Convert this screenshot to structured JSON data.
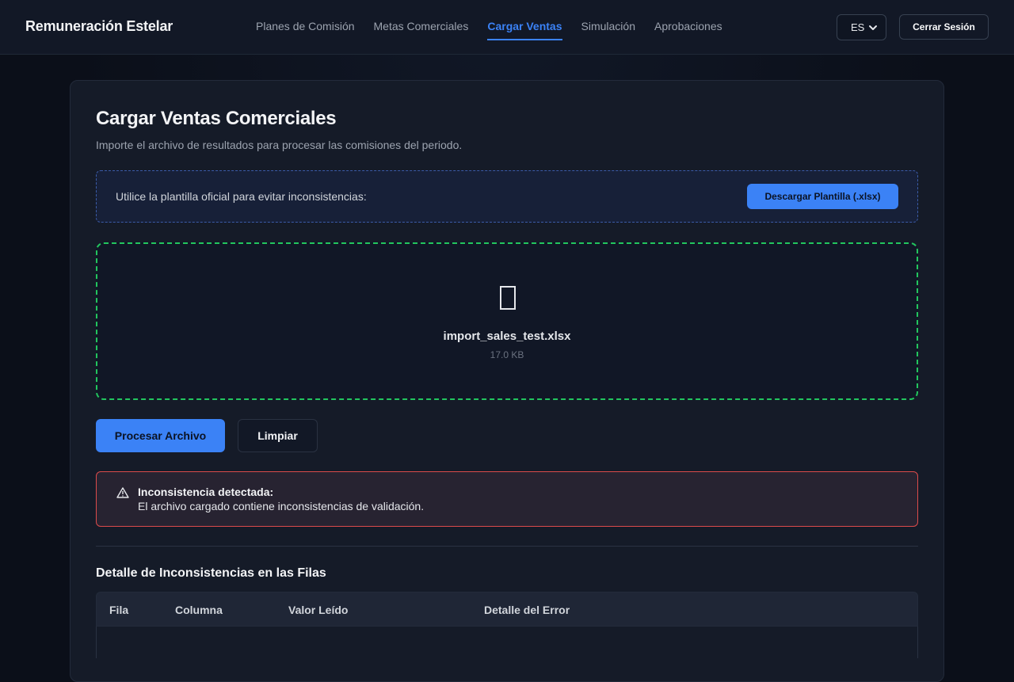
{
  "app": {
    "title": "Remuneración Estelar"
  },
  "nav": {
    "items": [
      {
        "label": "Planes de Comisión"
      },
      {
        "label": "Metas Comerciales"
      },
      {
        "label": "Cargar Ventas",
        "active": true
      },
      {
        "label": "Simulación"
      },
      {
        "label": "Aprobaciones"
      }
    ]
  },
  "header": {
    "language": "ES",
    "logout_label": "Cerrar Sesión"
  },
  "upload": {
    "title": "Cargar Ventas Comerciales",
    "subtitle": "Importe el archivo de resultados para procesar las comisiones del periodo.",
    "template_text": "Utilice la plantilla oficial para evitar inconsistencias:",
    "download_label": "Descargar Plantilla (.xlsx)",
    "file_name": "import_sales_test.xlsx",
    "file_size": "17.0 KB",
    "process_label": "Procesar Archivo",
    "clear_label": "Limpiar"
  },
  "alert": {
    "title": "Inconsistencia detectada:",
    "message": "El archivo cargado contiene inconsistencias de validación."
  },
  "errors": {
    "title": "Detalle de Inconsistencias en las Filas",
    "columns": [
      "Fila",
      "Columna",
      "Valor Leído",
      "Detalle del Error"
    ]
  },
  "colors": {
    "accent": "#3b82f6",
    "success_border": "#22c55e",
    "error_border": "#dc4b4b"
  }
}
